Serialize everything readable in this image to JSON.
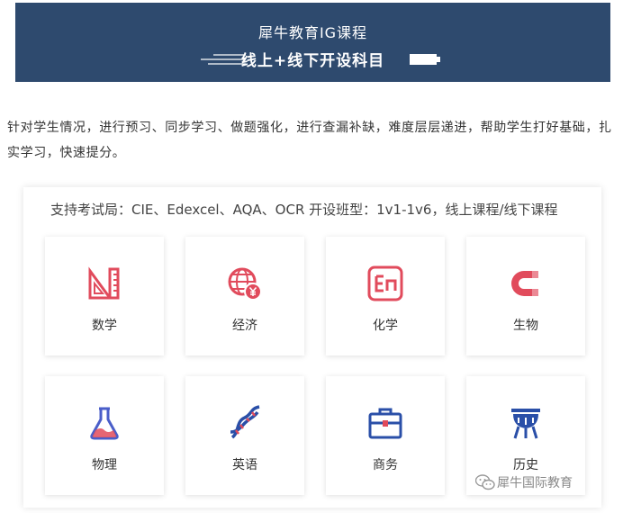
{
  "banner": {
    "title": "犀牛教育IG课程",
    "subtitle": "线上+线下开设科目"
  },
  "intro": {
    "text": "针对学生情况，进行预习、同步学习、做题强化，进行查漏补缺，难度层层递进，帮助学生打好基础，扎实学习，快速提分。"
  },
  "panel": {
    "title": "支持考试局：CIE、Edexcel、AQA、OCR 开设班型：1v1-1v6，线上课程/线下课程"
  },
  "subjects": [
    {
      "label": "数学",
      "icon": "ruler-triangle-icon",
      "color": "#e14b5c"
    },
    {
      "label": "经济",
      "icon": "globe-yen-icon",
      "color": "#e14b5c"
    },
    {
      "label": "化学",
      "icon": "en-element-icon",
      "color": "#e14b5c"
    },
    {
      "label": "生物",
      "icon": "magnet-icon",
      "color": "#e14b5c"
    },
    {
      "label": "物理",
      "icon": "flask-icon",
      "color": "#4a5ec9"
    },
    {
      "label": "英语",
      "icon": "dna-icon",
      "color": "#2a4fa8"
    },
    {
      "label": "商务",
      "icon": "briefcase-icon",
      "color": "#2a4fa8"
    },
    {
      "label": "历史",
      "icon": "bronze-vessel-icon",
      "color": "#2a4fa8"
    }
  ],
  "watermark": {
    "text": "犀牛国际教育",
    "icon": "wechat-icon"
  },
  "colors": {
    "banner_bg": "#2e4a6e",
    "accent_red": "#e14b5c",
    "accent_blue": "#2a4fa8"
  }
}
